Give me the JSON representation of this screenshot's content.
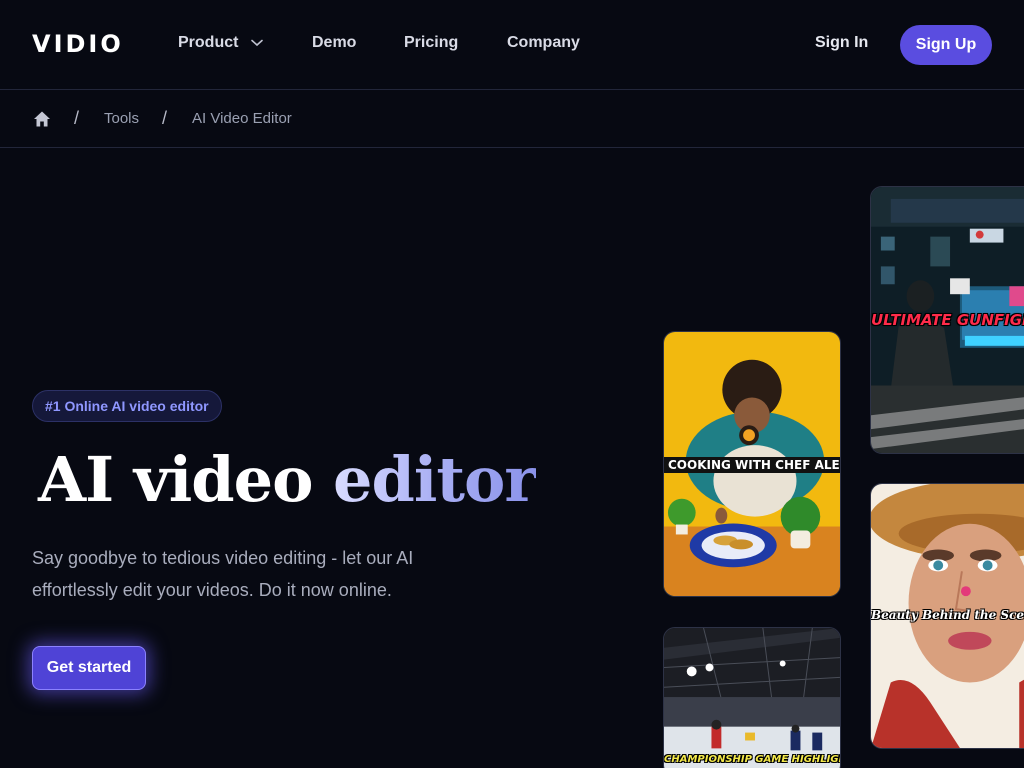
{
  "brand": {
    "logo": "VIDIO"
  },
  "nav": {
    "items": [
      {
        "label": "Product",
        "has_dropdown": true
      },
      {
        "label": "Demo"
      },
      {
        "label": "Pricing"
      },
      {
        "label": "Company"
      }
    ],
    "sign_in": "Sign In",
    "sign_up": "Sign Up"
  },
  "breadcrumb": {
    "home_icon": "home-icon",
    "separator": "/",
    "items": [
      "Tools",
      "AI Video Editor"
    ]
  },
  "hero": {
    "badge": "#1 Online AI video editor",
    "title_part1": "AI video",
    "title_part2": "editor",
    "description": "Say goodbye to tedious video editing - let our AI effortlessly edit your videos. Do it now online.",
    "cta": "Get started"
  },
  "videos": {
    "cooking": {
      "caption": "COOKING WITH CHEF ALEX"
    },
    "gaming": {
      "caption": "ULTIMATE GUNFIGHT"
    },
    "beauty": {
      "caption": "Beauty Behind the Scenes"
    },
    "hockey": {
      "caption": "CHAMPIONSHIP GAME HIGHLIGHTS"
    }
  },
  "colors": {
    "background": "#070912",
    "accent": "#5a4de0",
    "badge_text": "#8f97ff",
    "border": "#22263a"
  }
}
